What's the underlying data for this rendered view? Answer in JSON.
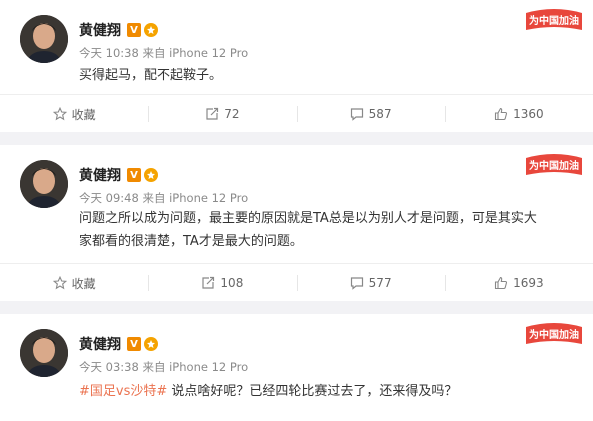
{
  "posts": [
    {
      "author": "黄健翔",
      "verified_mark": "V",
      "time": "今天 10:38",
      "source_prefix": "来自",
      "source": "iPhone 12 Pro",
      "text": "买得起马，配不起鞍子。",
      "topic": "",
      "sticker": "为中国加油",
      "actions": {
        "favorite": "收藏",
        "reposts": "72",
        "comments": "587",
        "likes": "1360"
      }
    },
    {
      "author": "黄健翔",
      "verified_mark": "V",
      "time": "今天 09:48",
      "source_prefix": "来自",
      "source": "iPhone 12 Pro",
      "text_line1": "问题之所以成为问题，最主要的原因就是TA总是以为别人才是问题，可是其实大",
      "text_line2": "家都看的很清楚，TA才是最大的问题。",
      "sticker": "为中国加油",
      "actions": {
        "favorite": "收藏",
        "reposts": "108",
        "comments": "577",
        "likes": "1693"
      }
    },
    {
      "author": "黄健翔",
      "verified_mark": "V",
      "time": "今天 03:38",
      "source_prefix": "来自",
      "source": "iPhone 12 Pro",
      "topic": "#国足vs沙特#",
      "text": " 说点啥好呢？已经四轮比赛过去了，还来得及吗？",
      "sticker": "为中国加油"
    }
  ],
  "colors": {
    "topic": "#eb7350",
    "verified": "#f08a00",
    "sticker": "#e8473c"
  }
}
